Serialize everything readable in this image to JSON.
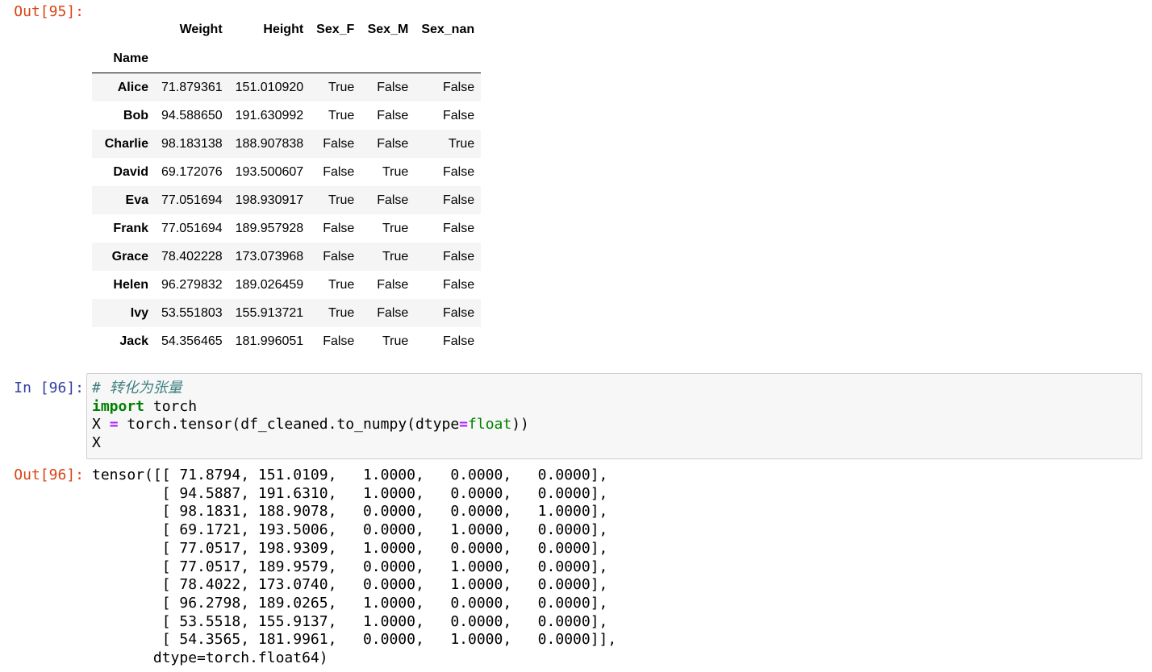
{
  "cells": {
    "out95_prompt": "Out[95]:",
    "in96_prompt": "In [96]:",
    "out96_prompt": "Out[96]:"
  },
  "dataframe": {
    "columns": [
      "Weight",
      "Height",
      "Sex_F",
      "Sex_M",
      "Sex_nan"
    ],
    "index_name": "Name",
    "rows": [
      {
        "name": "Alice",
        "values": [
          "71.879361",
          "151.010920",
          "True",
          "False",
          "False"
        ]
      },
      {
        "name": "Bob",
        "values": [
          "94.588650",
          "191.630992",
          "True",
          "False",
          "False"
        ]
      },
      {
        "name": "Charlie",
        "values": [
          "98.183138",
          "188.907838",
          "False",
          "False",
          "True"
        ]
      },
      {
        "name": "David",
        "values": [
          "69.172076",
          "193.500607",
          "False",
          "True",
          "False"
        ]
      },
      {
        "name": "Eva",
        "values": [
          "77.051694",
          "198.930917",
          "True",
          "False",
          "False"
        ]
      },
      {
        "name": "Frank",
        "values": [
          "77.051694",
          "189.957928",
          "False",
          "True",
          "False"
        ]
      },
      {
        "name": "Grace",
        "values": [
          "78.402228",
          "173.073968",
          "False",
          "True",
          "False"
        ]
      },
      {
        "name": "Helen",
        "values": [
          "96.279832",
          "189.026459",
          "True",
          "False",
          "False"
        ]
      },
      {
        "name": "Ivy",
        "values": [
          "53.551803",
          "155.913721",
          "True",
          "False",
          "False"
        ]
      },
      {
        "name": "Jack",
        "values": [
          "54.356465",
          "181.996051",
          "False",
          "True",
          "False"
        ]
      }
    ]
  },
  "code": {
    "comment": "# 转化为张量",
    "kw_import": "import",
    "import_rest": " torch",
    "line3_a": "X ",
    "eq": "=",
    "line3_b": " torch.tensor(df_cleaned.to_numpy(dtype",
    "line3_c": "float",
    "line3_d": "))",
    "line4": "X"
  },
  "tensor_output": "tensor([[ 71.8794, 151.0109,   1.0000,   0.0000,   0.0000],\n        [ 94.5887, 191.6310,   1.0000,   0.0000,   0.0000],\n        [ 98.1831, 188.9078,   0.0000,   0.0000,   1.0000],\n        [ 69.1721, 193.5006,   0.0000,   1.0000,   0.0000],\n        [ 77.0517, 198.9309,   1.0000,   0.0000,   0.0000],\n        [ 77.0517, 189.9579,   0.0000,   1.0000,   0.0000],\n        [ 78.4022, 173.0740,   0.0000,   1.0000,   0.0000],\n        [ 96.2798, 189.0265,   1.0000,   0.0000,   0.0000],\n        [ 53.5518, 155.9137,   1.0000,   0.0000,   0.0000],\n        [ 54.3565, 181.9961,   0.0000,   1.0000,   0.0000]],\n       dtype=torch.float64)"
}
